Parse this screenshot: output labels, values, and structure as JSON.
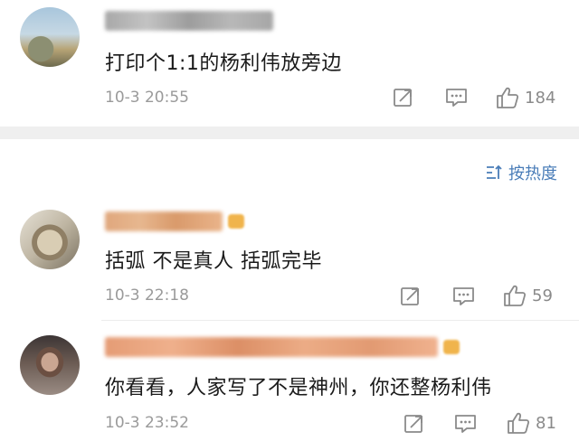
{
  "comments": [
    {
      "text": "打印个1:1的杨利伟放旁边",
      "time": "10-3 20:55",
      "likes": "184"
    },
    {
      "text": "括弧 不是真人 括弧完毕",
      "time": "10-3 22:18",
      "likes": "59"
    },
    {
      "text": "你看看，人家写了不是神州，你还整杨利伟",
      "time": "10-3 23:52",
      "likes": "81"
    }
  ],
  "sort": {
    "label": "按热度",
    "icon": "sort-icon"
  },
  "icons": {
    "share": "share-icon",
    "reply": "comment-icon",
    "like": "thumbs-up-icon"
  },
  "colors": {
    "accent": "#4a7db8",
    "meta_text": "#9a9a9a",
    "section_gap": "#efefef"
  }
}
